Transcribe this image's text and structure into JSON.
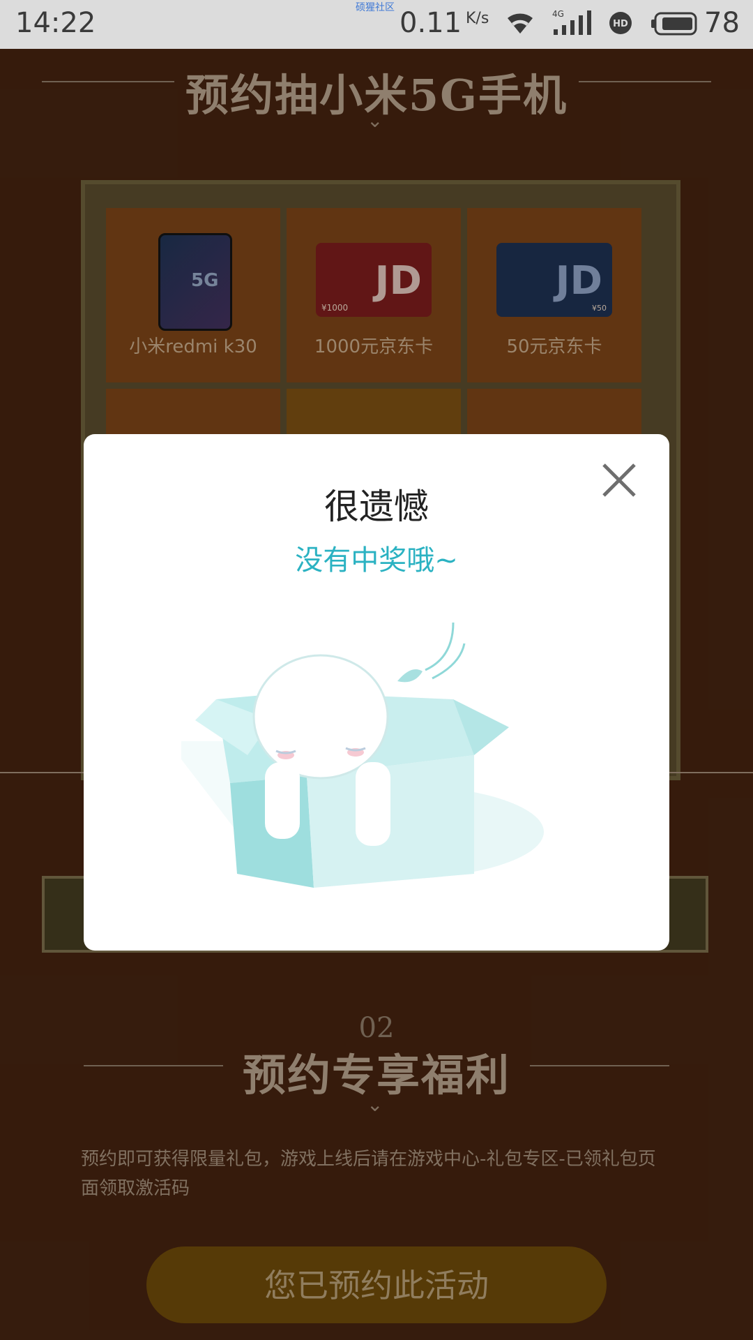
{
  "status_bar": {
    "time": "14:22",
    "center_label": "硕猩社区",
    "net_speed": "0.11",
    "net_speed_unit": "K/s",
    "network_type": "4G",
    "hd_badge": "HD",
    "battery": "78",
    "icons": [
      "wifi-icon",
      "signal-icon",
      "hd-icon",
      "battery-icon"
    ]
  },
  "page": {
    "section1_title": "预约抽小米5G手机",
    "prizes": [
      {
        "label": "小米redmi k30",
        "kind": "phone",
        "phone_text": "5G"
      },
      {
        "label": "1000元京东卡",
        "kind": "jd-card-red",
        "card_text": "JD",
        "amount": "¥1000"
      },
      {
        "label": "50元京东卡",
        "kind": "jd-card-blue",
        "card_text": "JD",
        "amount": "¥50"
      }
    ],
    "section2_number": "02",
    "section2_title": "预约专享福利",
    "description": "预约即可获得限量礼包，游戏上线后请在游戏中心-礼包专区-已领礼包页面领取激活码",
    "reserve_button": "您已预约此活动"
  },
  "modal": {
    "title": "很遗憾",
    "subtitle": "没有中奖哦~",
    "close_icon": "close-icon",
    "illustration": "empty-box-mascot",
    "colors": {
      "accent": "#2bb2c2",
      "box": "#bfecec",
      "box_dark": "#8fd8d8"
    }
  }
}
